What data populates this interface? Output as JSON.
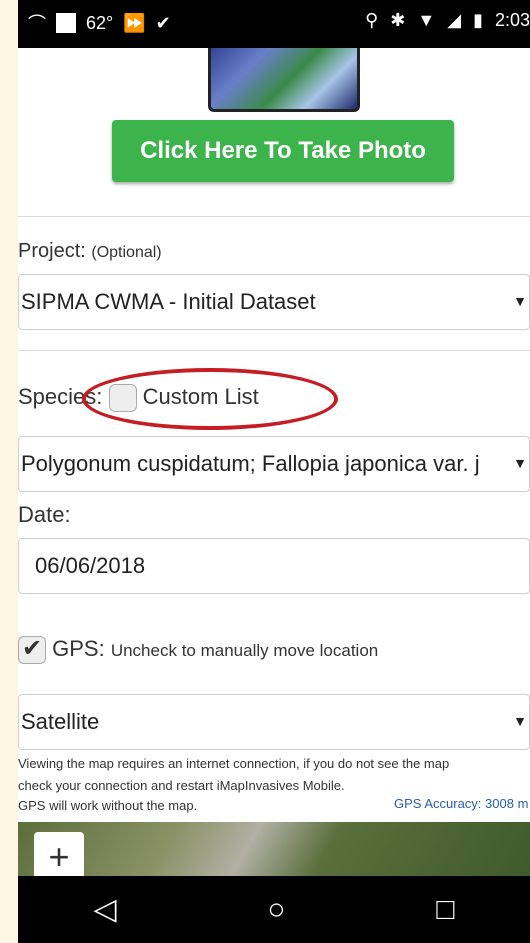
{
  "status": {
    "temp": "62°",
    "time": "2:03"
  },
  "photo_button": "Click Here To Take Photo",
  "project": {
    "label": "Project:",
    "optional": "(Optional)",
    "value": "SIPMA CWMA - Initial Dataset"
  },
  "species": {
    "label": "Species:",
    "custom_list_label": "Custom List",
    "value": "Polygonum cuspidatum; Fallopia japonica var. j"
  },
  "date": {
    "label": "Date:",
    "value": "06/06/2018"
  },
  "gps": {
    "label": "GPS:",
    "hint": "Uncheck to manually move location"
  },
  "map_type": "Satellite",
  "help": {
    "line1": "Viewing the map requires an internet connection, if you do not see the map",
    "line2": "check your connection and restart iMapInvasives Mobile.",
    "line3": "GPS will work without the map.",
    "accuracy": "GPS Accuracy: 3008 m"
  },
  "map": {
    "zoom_label": "+"
  }
}
